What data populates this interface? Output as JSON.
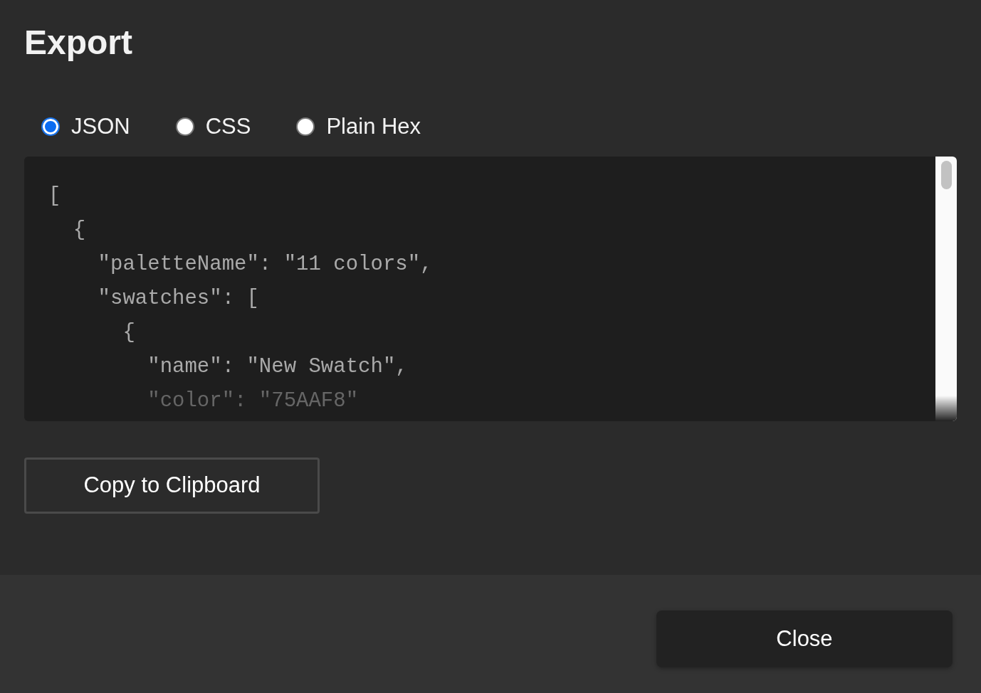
{
  "title": "Export",
  "formats": [
    {
      "label": "JSON",
      "selected": true
    },
    {
      "label": "CSS",
      "selected": false
    },
    {
      "label": "Plain Hex",
      "selected": false
    }
  ],
  "code_lines": [
    "[",
    "  {",
    "    \"paletteName\": \"11 colors\",",
    "    \"swatches\": [",
    "      {",
    "        \"name\": \"New Swatch\",",
    "        \"color\": \"75AAF8\""
  ],
  "copy_button": "Copy to Clipboard",
  "close_button": "Close"
}
